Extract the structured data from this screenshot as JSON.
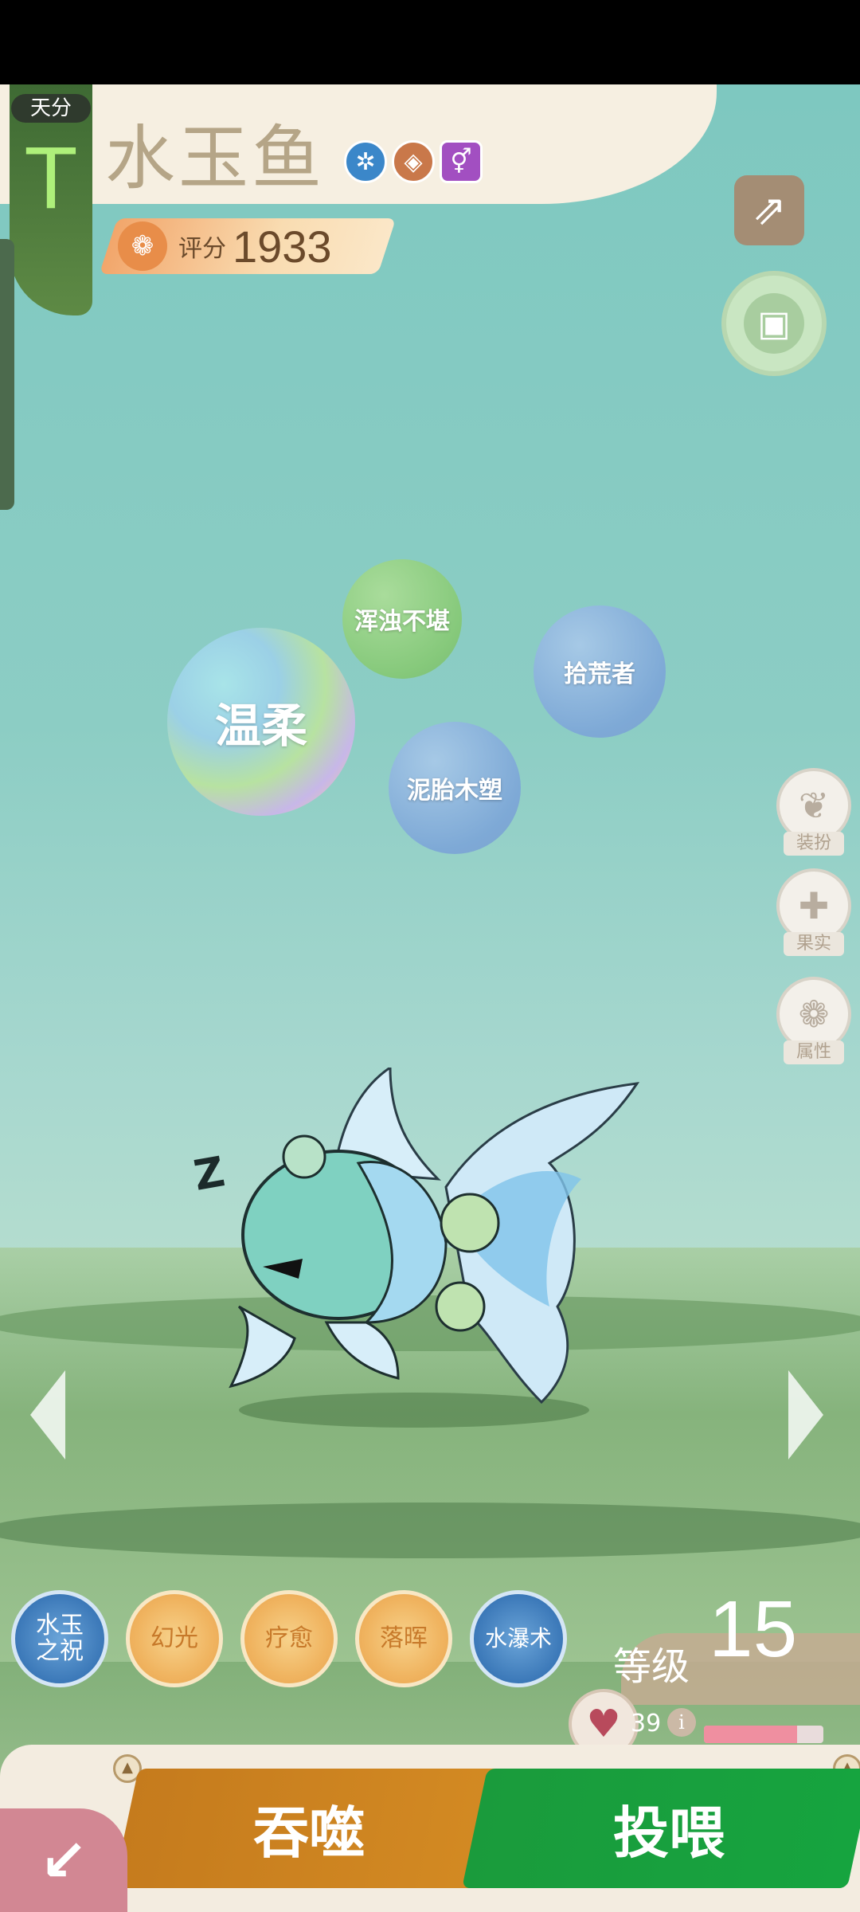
{
  "header": {
    "tier_label": "天分",
    "tier_letter": "T",
    "pet_name": "水玉鱼",
    "badges": [
      {
        "icon": "water-element-icon",
        "color": "#3b87c9",
        "glyph": "✲"
      },
      {
        "icon": "ground-element-icon",
        "color": "#c9784a",
        "glyph": "◈"
      },
      {
        "icon": "gender-icon",
        "color": "#a24fc1",
        "glyph": "⚥"
      }
    ],
    "score_label": "评分",
    "score_value": "1933"
  },
  "traits": [
    {
      "label": "温柔"
    },
    {
      "label": "浑浊不堪"
    },
    {
      "label": "拾荒者"
    },
    {
      "label": "泥胎木塑"
    }
  ],
  "side_buttons": [
    {
      "label": "装扮",
      "icon": "butterfly-icon",
      "glyph": "❦"
    },
    {
      "label": "果实",
      "icon": "plus-icon",
      "glyph": "✚"
    },
    {
      "label": "属性",
      "icon": "paw-icon",
      "glyph": "❁"
    }
  ],
  "creature": {
    "sleep_mark": "Z"
  },
  "skills": [
    {
      "label": "水玉\n之祝",
      "style": "blue"
    },
    {
      "label": "幻光",
      "style": "orange"
    },
    {
      "label": "疗愈",
      "style": "orange"
    },
    {
      "label": "落晖",
      "style": "orange"
    },
    {
      "label": "水瀑术",
      "style": "blue"
    }
  ],
  "level": {
    "label": "等级",
    "value": "15"
  },
  "health": {
    "value": "39",
    "info_glyph": "i",
    "fill_fraction": 0.78
  },
  "actions": {
    "devour_label": "吞噬",
    "feed_label": "投喂",
    "corner_glyph": "↙"
  },
  "colors": {
    "devour": "#c57b1d",
    "feed": "#16a43f",
    "accent_tier": "#aef07a"
  }
}
